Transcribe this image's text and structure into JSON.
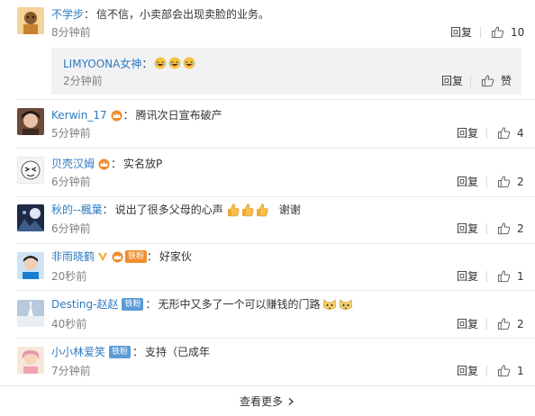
{
  "comments": [
    {
      "user": "不学步",
      "text": "信不信，小卖部会出现卖脸的业务。",
      "time": "8分钟前",
      "reply": "回复",
      "likes": "10"
    },
    {
      "user": "Kerwin_17",
      "text": "腾讯次日宣布破产",
      "time": "5分钟前",
      "reply": "回复",
      "likes": "4"
    },
    {
      "user": "贝壳汉姆",
      "text": "实名放P",
      "time": "6分钟前",
      "reply": "回复",
      "likes": "2"
    },
    {
      "user": "秋的--楓葉",
      "text": "说出了很多父母的心声",
      "text_tail": "谢谢",
      "time": "6分钟前",
      "reply": "回复",
      "likes": "2"
    },
    {
      "user": "非雨晓鹤",
      "badge": "铁粉",
      "text": "好家伙",
      "time": "20秒前",
      "reply": "回复",
      "likes": "1"
    },
    {
      "user": "Desting-赵赵",
      "badge": "铁粉",
      "text": "无形中又多了一个可以赚钱的门路",
      "time": "40秒前",
      "reply": "回复",
      "likes": "2"
    },
    {
      "user": "小小林爱笑",
      "badge": "铁粉",
      "text": "支持（已成年",
      "time": "7分钟前",
      "reply": "回复",
      "likes": "1"
    }
  ],
  "sub_reply": {
    "user": "LIMYOONA女神",
    "time": "2分钟前",
    "reply": "回复",
    "like_label": "赞"
  },
  "load_more": "查看更多",
  "colors": {
    "name_orange": "#eb7350",
    "name_blue": "#2d7ac0",
    "sub_bg": "#f2f2f5"
  },
  "icons": [
    "thumbs-up-icon",
    "chevron-right-icon",
    "laughing-face-icon",
    "thumbs-up-emoji-icon",
    "cat-face-icon",
    "crown-icon",
    "v-verified-icon"
  ]
}
